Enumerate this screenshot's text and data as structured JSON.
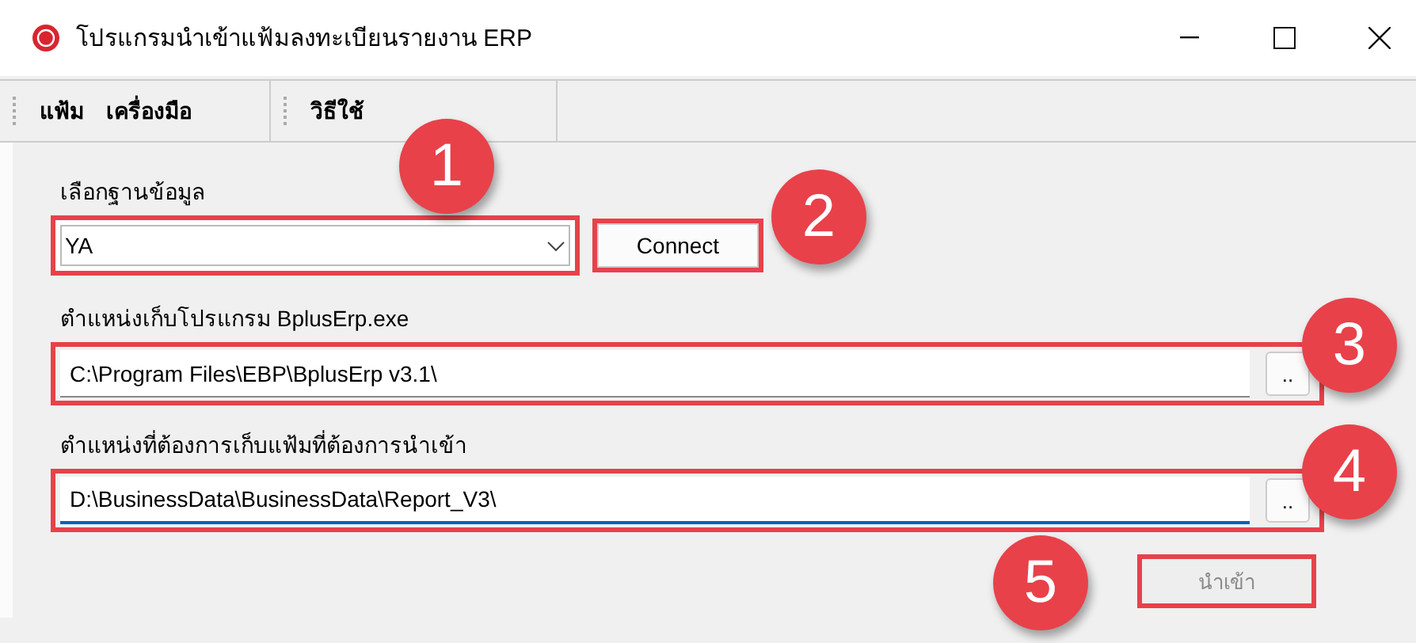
{
  "window": {
    "title": "โปรแกรมนำเข้าแฟ้มลงทะเบียนรายงาน ERP"
  },
  "menu_bar": [
    {
      "items": [
        "แฟ้ม",
        "เครื่องมือ"
      ]
    },
    {
      "items": [
        "วิธีใช้"
      ]
    }
  ],
  "database": {
    "label": "เลือกฐานข้อมูล",
    "value": "YA",
    "connect_button": "Connect"
  },
  "fields": [
    {
      "label": "ตำแหน่งเก็บโปรแกรม BplusErp.exe",
      "value": "C:\\Program Files\\EBP\\BplusErp v3.1\\",
      "browse_button": "..",
      "focused": false
    },
    {
      "label": "ตำแหน่งที่ต้องการเก็บแฟ้มที่ต้องการนำเข้า",
      "value": "D:\\BusinessData\\BusinessData\\Report_V3\\",
      "browse_button": "..",
      "focused": true
    }
  ],
  "import_button": {
    "label": "นำเข้า",
    "disabled": true
  },
  "annotations": [
    "1",
    "2",
    "3",
    "4",
    "5"
  ]
}
